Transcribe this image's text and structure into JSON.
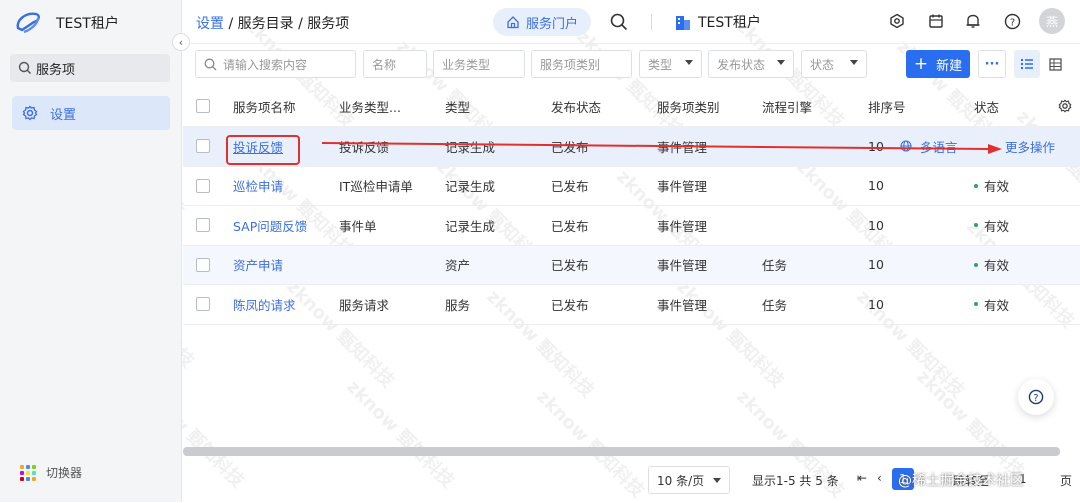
{
  "sidebar": {
    "tenant": "TEST租户",
    "search_value": "服务项",
    "menu": [
      {
        "label": "设置"
      }
    ],
    "switcher_label": "切换器"
  },
  "header": {
    "breadcrumb": {
      "root": "设置",
      "sep1": "/",
      "mid": "服务目录",
      "sep2": "/",
      "current": "服务项"
    },
    "portal_label": "服务门户",
    "tenant": "TEST租户",
    "avatar_text": "燕"
  },
  "filters": {
    "search_placeholder": "请输入搜索内容",
    "name": "名称",
    "business_type": "业务类型",
    "item_category": "服务项类别",
    "type": "类型",
    "publish_status": "发布状态",
    "status": "状态",
    "new_button": "新建",
    "more_button": "···"
  },
  "table": {
    "columns": [
      "服务项名称",
      "业务类型...",
      "类型",
      "发布状态",
      "服务项类别",
      "流程引擎",
      "排序号",
      "状态"
    ],
    "rows": [
      {
        "name": "投诉反馈",
        "business": "投诉反馈",
        "type": "记录生成",
        "publish": "已发布",
        "category": "事件管理",
        "engine": "",
        "order": "10",
        "status": "",
        "extra_lang": "多语言",
        "extra_more": "更多操作"
      },
      {
        "name": "巡检申请",
        "business": "IT巡检申请单",
        "type": "记录生成",
        "publish": "已发布",
        "category": "事件管理",
        "engine": "",
        "order": "10",
        "status": "有效"
      },
      {
        "name": "SAP问题反馈",
        "business": "事件单",
        "type": "记录生成",
        "publish": "已发布",
        "category": "事件管理",
        "engine": "",
        "order": "10",
        "status": "有效"
      },
      {
        "name": "资产申请",
        "business": "",
        "type": "资产",
        "publish": "已发布",
        "category": "事件管理",
        "engine": "任务",
        "order": "10",
        "status": "有效"
      },
      {
        "name": "陈凤的请求",
        "business": "服务请求",
        "type": "服务",
        "publish": "已发布",
        "category": "事件管理",
        "engine": "任务",
        "order": "10",
        "status": "有效"
      }
    ]
  },
  "pager": {
    "page_size": "10 条/页",
    "summary": "显示1-5 共 5 条",
    "current_page": "1",
    "goto_label": "跳转至",
    "goto_value": "1",
    "page_suffix": "页"
  },
  "watermark": {
    "text": "zknow 甄知科技",
    "footer": "@稀土掘金技术社区"
  },
  "colors": {
    "accent": "#2a6ef0",
    "status_green": "#2fa65a",
    "annotation_red": "#e03030"
  }
}
